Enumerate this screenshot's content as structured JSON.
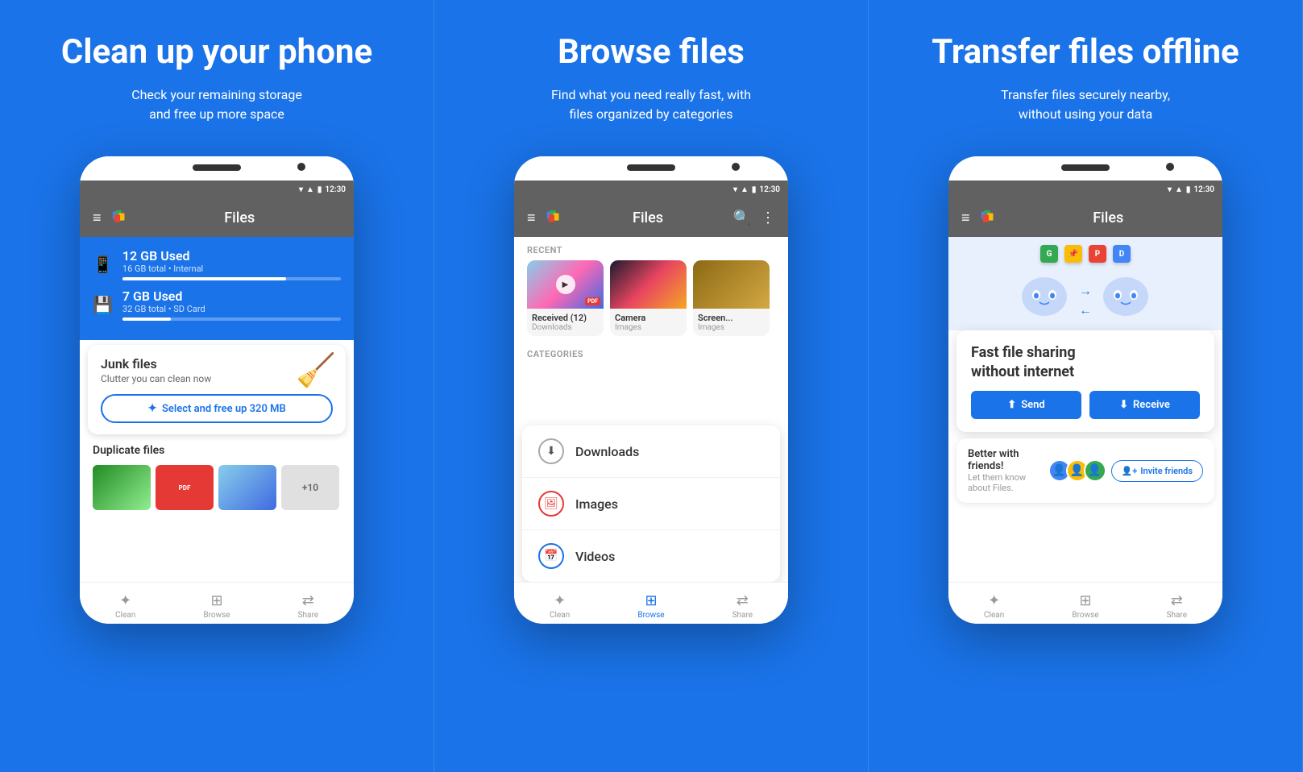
{
  "panels": [
    {
      "id": "clean",
      "title": "Clean up your phone",
      "subtitle": "Check your remaining storage\nand free up more space",
      "storage": [
        {
          "label": "12 GB Used",
          "sub": "16 GB total • Internal",
          "fill": 75,
          "icon": "📱"
        },
        {
          "label": "7 GB Used",
          "sub": "32 GB total • SD Card",
          "fill": 22,
          "icon": "💾"
        }
      ],
      "junk": {
        "title": "Junk files",
        "sub": "Clutter you can clean now",
        "button": "Select and free up 320 MB"
      },
      "duplicate": {
        "title": "Duplicate files"
      },
      "nav": [
        {
          "label": "Clean",
          "icon": "✦",
          "active": false
        },
        {
          "label": "Browse",
          "icon": "⊞",
          "active": false
        },
        {
          "label": "Share",
          "icon": "⇄",
          "active": false
        }
      ]
    },
    {
      "id": "browse",
      "title": "Browse files",
      "subtitle": "Find what you need really fast, with\nfiles organized by categories",
      "recent_label": "RECENT",
      "recent_items": [
        {
          "name": "Received (12)",
          "type": "Downloads",
          "thumb": "sky",
          "has_play": true,
          "has_pdf": true
        },
        {
          "name": "Camera",
          "type": "Images",
          "thumb": "sunset",
          "has_play": false,
          "has_pdf": false
        },
        {
          "name": "Screen...",
          "type": "Images",
          "thumb": "food",
          "has_play": false,
          "has_pdf": false
        }
      ],
      "categories_label": "CATEGORIES",
      "categories": [
        {
          "name": "Downloads",
          "icon": "⬇"
        },
        {
          "name": "Images",
          "icon": "🖼"
        },
        {
          "name": "Videos",
          "icon": "📅"
        }
      ],
      "nav": [
        {
          "label": "Clean",
          "icon": "✦",
          "active": false
        },
        {
          "label": "Browse",
          "icon": "⊞",
          "active": true
        },
        {
          "label": "Share",
          "icon": "⇄",
          "active": false
        }
      ]
    },
    {
      "id": "transfer",
      "title": "Transfer files offline",
      "subtitle": "Transfer files securely nearby,\nwithout using your data",
      "transfer_card": {
        "title": "Fast file sharing\nwithout internet",
        "send_label": "Send",
        "receive_label": "Receive"
      },
      "friends_card": {
        "title": "Better with friends!",
        "sub": "Let them know about Files.",
        "button": "Invite friends"
      },
      "nav": [
        {
          "label": "Clean",
          "icon": "✦",
          "active": false
        },
        {
          "label": "Browse",
          "icon": "⊞",
          "active": false
        },
        {
          "label": "Share",
          "icon": "⇄",
          "active": false
        }
      ]
    }
  ],
  "app": {
    "name": "Files",
    "time": "12:30"
  }
}
